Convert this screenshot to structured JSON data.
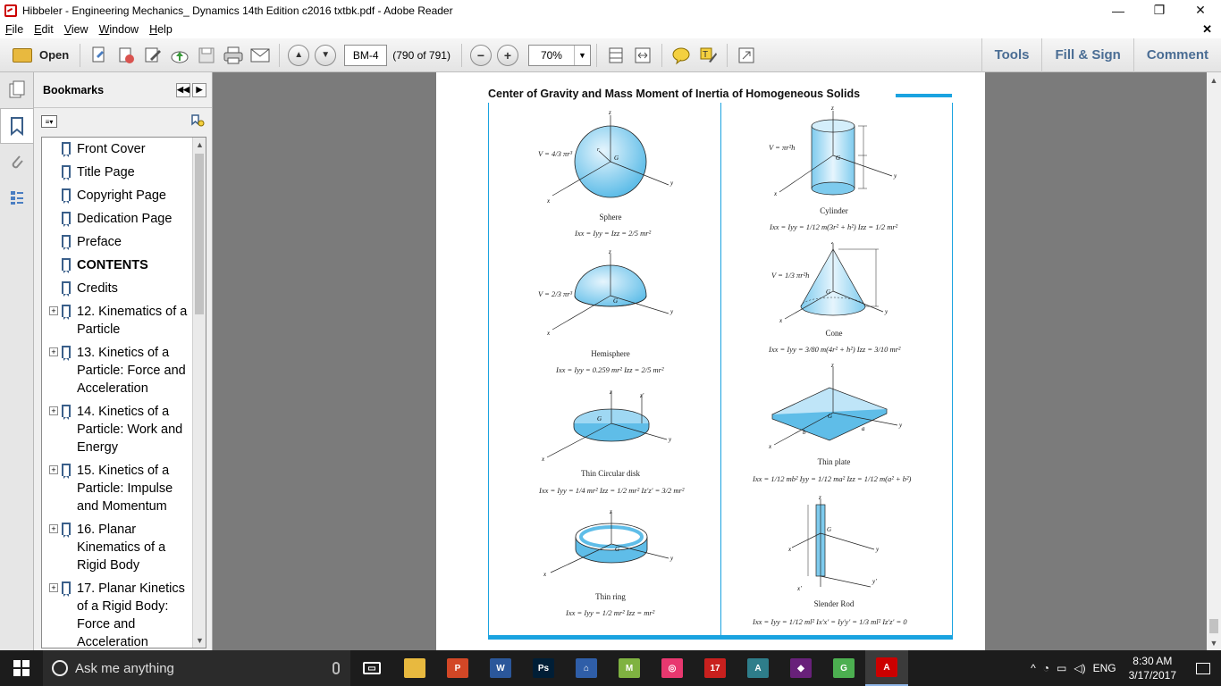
{
  "window": {
    "title": "Hibbeler - Engineering Mechanics_ Dynamics 14th Edition c2016 txtbk.pdf - Adobe Reader",
    "minimize_icon": "—",
    "restore_icon": "❐",
    "close_icon": "✕"
  },
  "menu": {
    "items": [
      "File",
      "Edit",
      "View",
      "Window",
      "Help"
    ],
    "close_doc": "✕"
  },
  "toolbar": {
    "open_label": "Open",
    "page_label": "BM-4",
    "page_count": "(790 of 791)",
    "zoom_value": "70%",
    "minus": "−",
    "plus": "+",
    "prev": "▲",
    "next": "▼",
    "tools_label": "Tools",
    "fillsign_label": "Fill & Sign",
    "comment_label": "Comment"
  },
  "bookmarks": {
    "header": "Bookmarks",
    "collapse_btn": "◀◀",
    "expand_btn": "▶",
    "items": [
      {
        "label": "Front Cover",
        "expandable": false
      },
      {
        "label": "Title Page",
        "expandable": false
      },
      {
        "label": "Copyright Page",
        "expandable": false
      },
      {
        "label": "Dedication Page",
        "expandable": false
      },
      {
        "label": "Preface",
        "expandable": false
      },
      {
        "label": "CONTENTS",
        "expandable": false,
        "bold": true
      },
      {
        "label": "Credits",
        "expandable": false
      },
      {
        "label": "12. Kinematics of a Particle",
        "expandable": true
      },
      {
        "label": "13. Kinetics of a Particle: Force and Acceleration",
        "expandable": true
      },
      {
        "label": "14. Kinetics of a Particle: Work and Energy",
        "expandable": true
      },
      {
        "label": "15. Kinetics of a Particle: Impulse and Momentum",
        "expandable": true
      },
      {
        "label": "16. Planar Kinematics of a Rigid Body",
        "expandable": true
      },
      {
        "label": "17. Planar Kinetics of a Rigid Body: Force and Acceleration",
        "expandable": true
      }
    ]
  },
  "document": {
    "page_title": "Center of Gravity and Mass Moment of Inertia of Homogeneous Solids",
    "figures": {
      "sphere": {
        "caption": "Sphere",
        "formula": "Ixx = Iyy = Izz = 2/5 mr²",
        "volume": "V = 4/3 πr³"
      },
      "cylinder": {
        "caption": "Cylinder",
        "formula": "Ixx = Iyy = 1/12 m(3r² + h²)   Izz = 1/2 mr²",
        "volume": "V = πr²h"
      },
      "hemisphere": {
        "caption": "Hemisphere",
        "formula": "Ixx = Iyy = 0.259 mr²   Izz = 2/5 mr²",
        "volume": "V = 2/3 πr³"
      },
      "cone": {
        "caption": "Cone",
        "formula": "Ixx = Iyy = 3/80 m(4r² + h²)   Izz = 3/10 mr²",
        "volume": "V = 1/3 πr²h"
      },
      "disk": {
        "caption": "Thin Circular disk",
        "formula": "Ixx = Iyy = 1/4 mr²  Izz = 1/2 mr²  Iz'z' = 3/2 mr²"
      },
      "plate": {
        "caption": "Thin plate",
        "formula": "Ixx = 1/12 mb²  Iyy = 1/12 ma²  Izz = 1/12 m(a² + b²)"
      },
      "ring": {
        "caption": "Thin ring",
        "formula": "Ixx = Iyy = 1/2 mr²   Izz = mr²"
      },
      "rod": {
        "caption": "Slender Rod",
        "formula": "Ixx = Iyy = 1/12 ml²   Ix'x' = Iy'y' = 1/3 ml²   Iz'z' = 0"
      }
    }
  },
  "taskbar": {
    "search_placeholder": "Ask me anything",
    "apps": [
      {
        "name": "task-view",
        "color": "#1c1c1c",
        "glyph": "▭"
      },
      {
        "name": "file-explorer",
        "color": "#e8b93f",
        "glyph": ""
      },
      {
        "name": "powerpoint",
        "color": "#d24726",
        "glyph": "P"
      },
      {
        "name": "word",
        "color": "#2b579a",
        "glyph": "W"
      },
      {
        "name": "photoshop",
        "color": "#001e36",
        "glyph": "Ps"
      },
      {
        "name": "app-tower",
        "color": "#2f5ea8",
        "glyph": "⌂"
      },
      {
        "name": "minitab",
        "color": "#7fb241",
        "glyph": "M"
      },
      {
        "name": "search-app",
        "color": "#e8386f",
        "glyph": "◎"
      },
      {
        "name": "maple",
        "color": "#c8201e",
        "glyph": "17"
      },
      {
        "name": "matlab-app",
        "color": "#2e7d8a",
        "glyph": "A"
      },
      {
        "name": "visual-studio",
        "color": "#68217a",
        "glyph": "◆"
      },
      {
        "name": "cleaner-app",
        "color": "#4caf50",
        "glyph": "G"
      },
      {
        "name": "adobe-reader",
        "color": "#c00",
        "glyph": "A",
        "active": true
      }
    ],
    "lang": "ENG",
    "time": "8:30 AM",
    "date": "3/17/2017"
  }
}
